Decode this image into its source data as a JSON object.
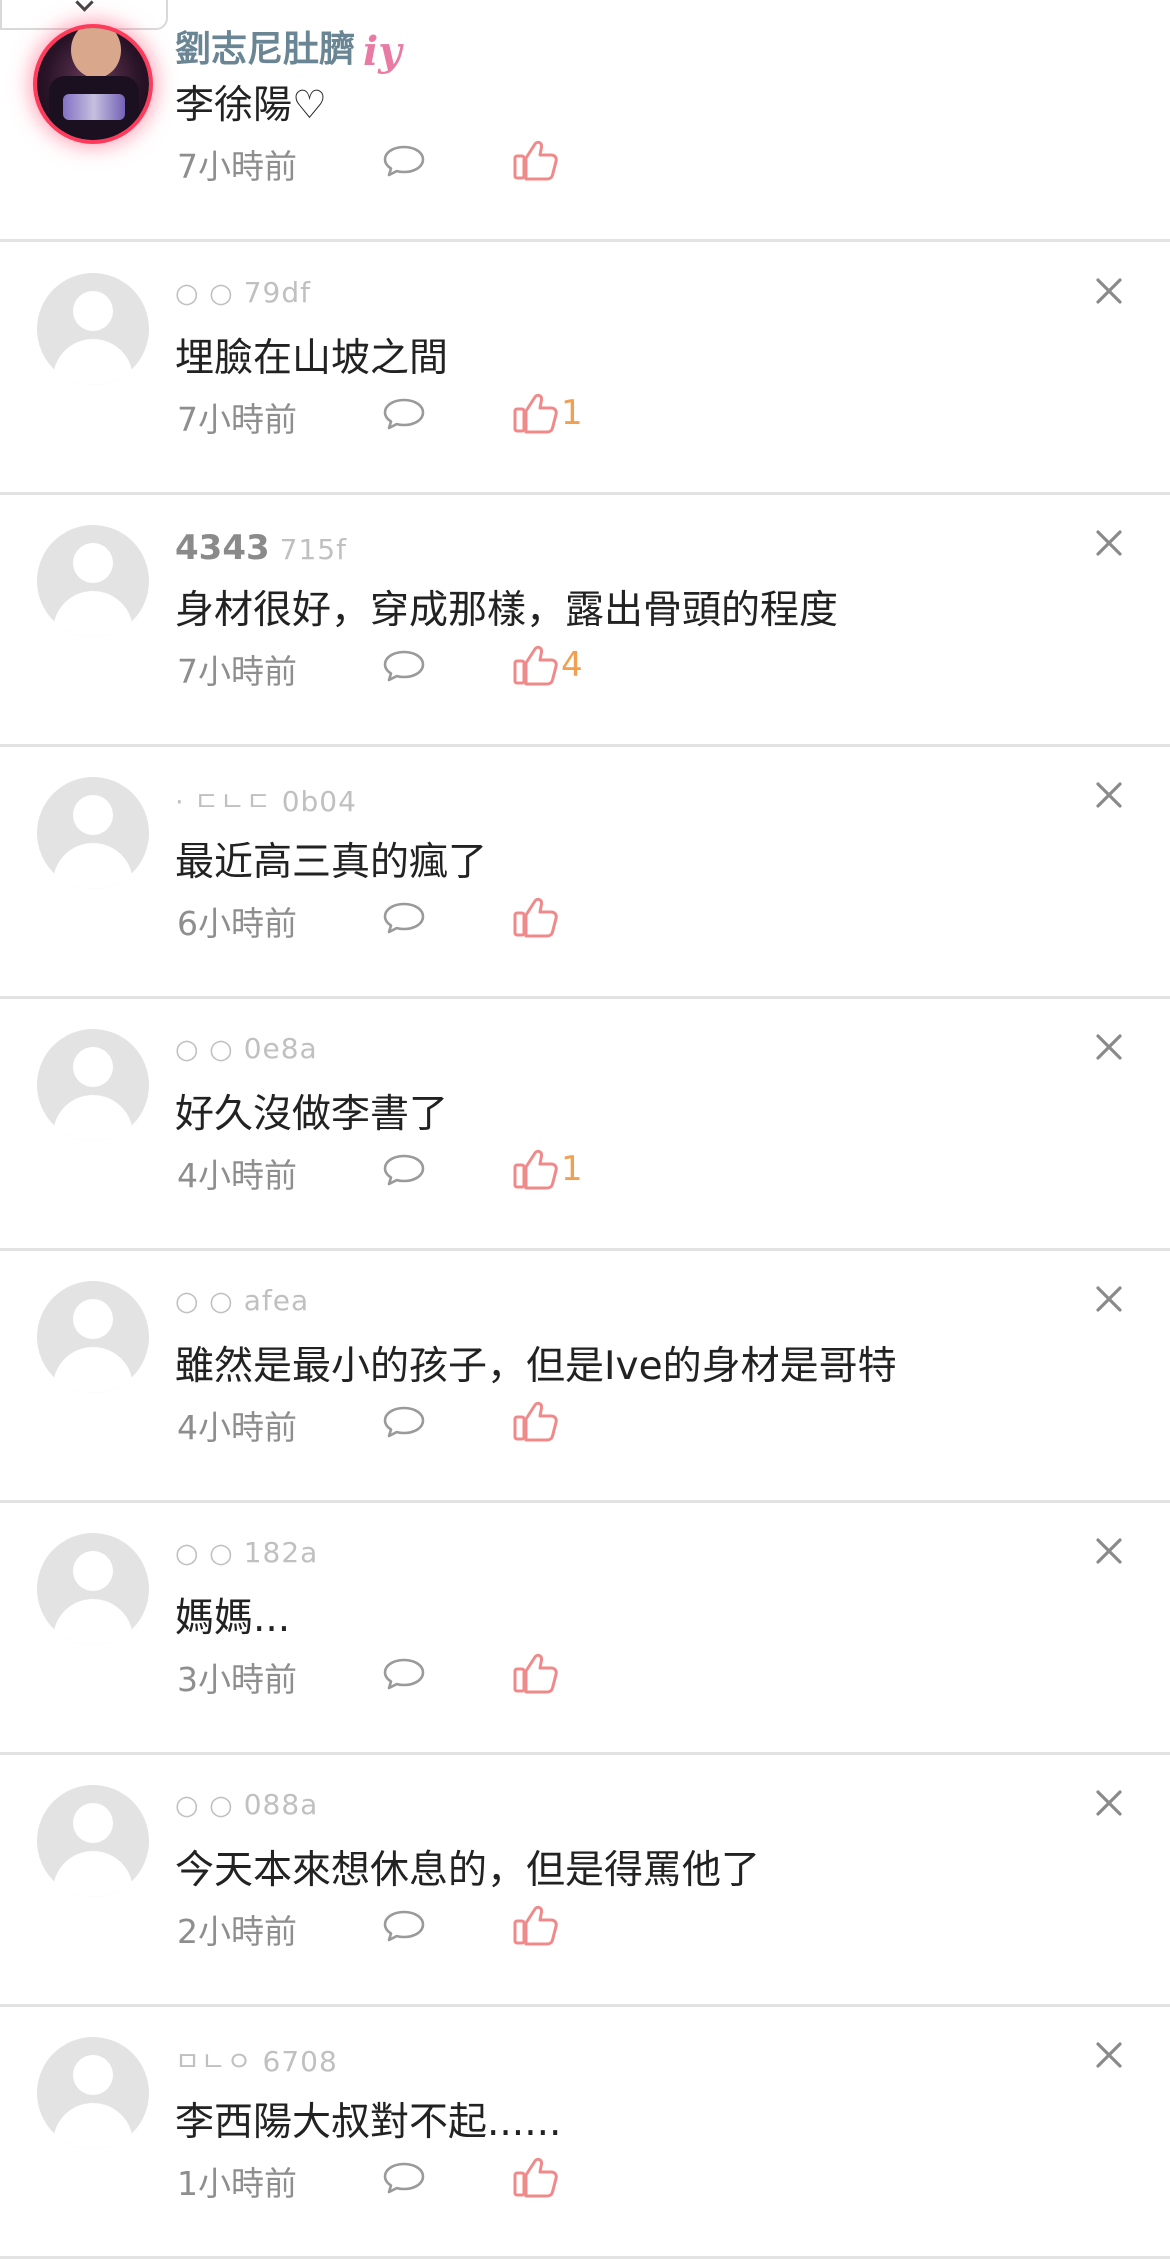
{
  "comments": [
    {
      "user": "劉志尼肚臍",
      "vip": true,
      "badge": "iy",
      "text": "李徐陽♡",
      "time": "7小時前",
      "likes": "",
      "closable": false,
      "avatar": "photo"
    },
    {
      "user": "○ ○",
      "tag": "79df",
      "text": "埋臉在山坡之間",
      "time": "7小時前",
      "likes": "1",
      "closable": true,
      "avatar": "default"
    },
    {
      "user": "4343",
      "tag": "715f",
      "text": "身材很好，穿成那樣，露出骨頭的程度",
      "time": "7小時前",
      "likes": "4",
      "closable": true,
      "avatar": "default",
      "bold_user": true
    },
    {
      "user": "· ㄷㄴㄷ",
      "tag": "0b04",
      "text": "最近高三真的瘋了",
      "time": "6小時前",
      "likes": "",
      "closable": true,
      "avatar": "default"
    },
    {
      "user": "○ ○",
      "tag": "0e8a",
      "text": "好久沒做李書了",
      "time": "4小時前",
      "likes": "1",
      "closable": true,
      "avatar": "default"
    },
    {
      "user": "○ ○",
      "tag": "afea",
      "text": "雖然是最小的孩子，但是Ive的身材是哥特",
      "time": "4小時前",
      "likes": "",
      "closable": true,
      "avatar": "default"
    },
    {
      "user": "○ ○",
      "tag": "182a",
      "text": "媽媽...",
      "time": "3小時前",
      "likes": "",
      "closable": true,
      "avatar": "default"
    },
    {
      "user": "○ ○",
      "tag": "088a",
      "text": "今天本來想休息的，但是得罵他了",
      "time": "2小時前",
      "likes": "",
      "closable": true,
      "avatar": "default"
    },
    {
      "user": "ㅁㄴㅇ",
      "tag": "6708",
      "text": "李西陽大叔對不起......",
      "time": "1小時前",
      "likes": "",
      "closable": true,
      "avatar": "default"
    }
  ],
  "colors": {
    "like_icon": "#f08a8a",
    "like_count": "#f0a050",
    "vip_name": "#6a8593",
    "divider": "#e3e3e3"
  },
  "icons": {
    "reply": "speech-bubble-icon",
    "like": "thumbs-up-icon",
    "close": "close-icon",
    "collapse": "chevron-down-icon"
  }
}
